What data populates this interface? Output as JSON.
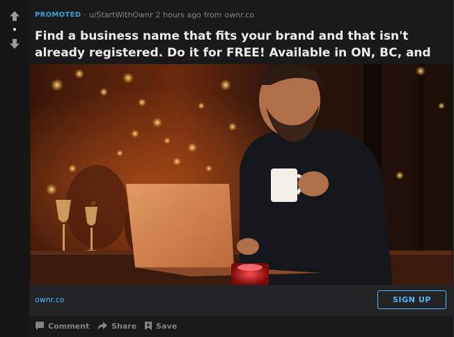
{
  "post": {
    "promoted_label": "PROMOTED",
    "separator": "·",
    "username": "u/StartWithOwnr",
    "time": "2 hours ago",
    "from_label": "from",
    "source": "ownr.co",
    "title": "Find a business name that fits your brand and that isn't already registered. Do it for FREE! Available in ON, BC, and AB.",
    "score": "•"
  },
  "link_bar": {
    "domain": "ownr.co",
    "cta_label": "SIGN UP"
  },
  "actions": {
    "comment_label": "Comment",
    "share_label": "Share",
    "save_label": "Save"
  },
  "colors": {
    "promoted": "#3aa0d8",
    "link": "#4fbcff",
    "background": "#1a1a1b",
    "muted": "#818384"
  }
}
